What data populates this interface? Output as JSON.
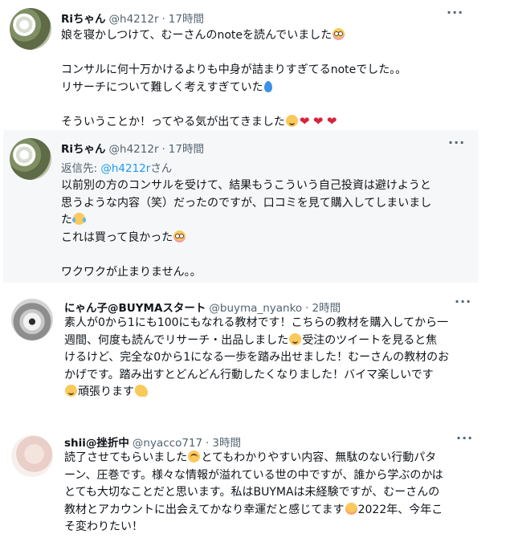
{
  "tweets": [
    {
      "name": "Riちゃん",
      "handle": "@h4212r",
      "dot": "·",
      "time": "17時間",
      "more": "···",
      "lines": [
        "娘を寝かしつけて、むーさんのnoteを読んでいました",
        "",
        "コンサルに何十万かけるよりも中身が詰まりすぎてるnoteでした。。",
        "リサーチについて難しく考えすぎていた",
        "",
        "そういうことか！ってやる気が出てきました"
      ]
    },
    {
      "name": "Riちゃん",
      "handle": "@h4212r",
      "dot": "·",
      "time": "17時間",
      "more": "···",
      "reply_prefix": "返信先: ",
      "reply_to": "@h4212r",
      "reply_suffix": "さん",
      "lines": [
        "以前別の方のコンサルを受けて、結果もうこういう自己投資は避けようと",
        "思うような内容（笑）だったのですが、口コミを見て購入してしまいまし",
        "た",
        "これは買って良かった",
        "",
        "ワクワクが止まりません。。"
      ]
    },
    {
      "name": "にゃん子@BUYMAスタート",
      "handle": "@buyma_nyanko",
      "dot": "·",
      "time": "2時間",
      "more": "···",
      "lines": [
        "素人が0から1にも100にもなれる教材です！こちらの教材を購入してから一",
        "週間、何度も読んでリサーチ・出品しました",
        "けるけど、完全な0から1になる一歩を踏み出せました！むーさんの教材のお",
        "かげです。踏み出すとどんどん行動したくなりました！バイマ楽しいです",
        "頑張ります"
      ],
      "line2_tail": "受注のツイートを見ると焦"
    },
    {
      "name": "shii@挫折中",
      "handle": "@nyacco717",
      "dot": "·",
      "time": "3時間",
      "more": "···",
      "lines": [
        "読了させてもらいました",
        "ーン、圧巻です。様々な情報が溢れている世の中ですが、誰から学ぶのかは",
        "とても大切なことだと思います。私はBUYMAは未経験ですが、むーさんの",
        "教材とアカウントに出会えてかなり幸運だと感じてます",
        "そ変わりたい！"
      ],
      "line1_tail": "とてもわかりやすい内容、無駄のない行動パタ",
      "line4_tail": "2022年、今年こ"
    }
  ],
  "icons": {
    "flushed": "flushed-face-emoji",
    "drop": "droplet-emoji",
    "heart": "red-heart-emoji",
    "joy": "tears-of-joy-emoji",
    "smile": "smiling-face-emoji",
    "muscle": "flexed-biceps-emoji",
    "relieved": "relieved-face-emoji",
    "persevere": "persevering-face-emoji"
  }
}
